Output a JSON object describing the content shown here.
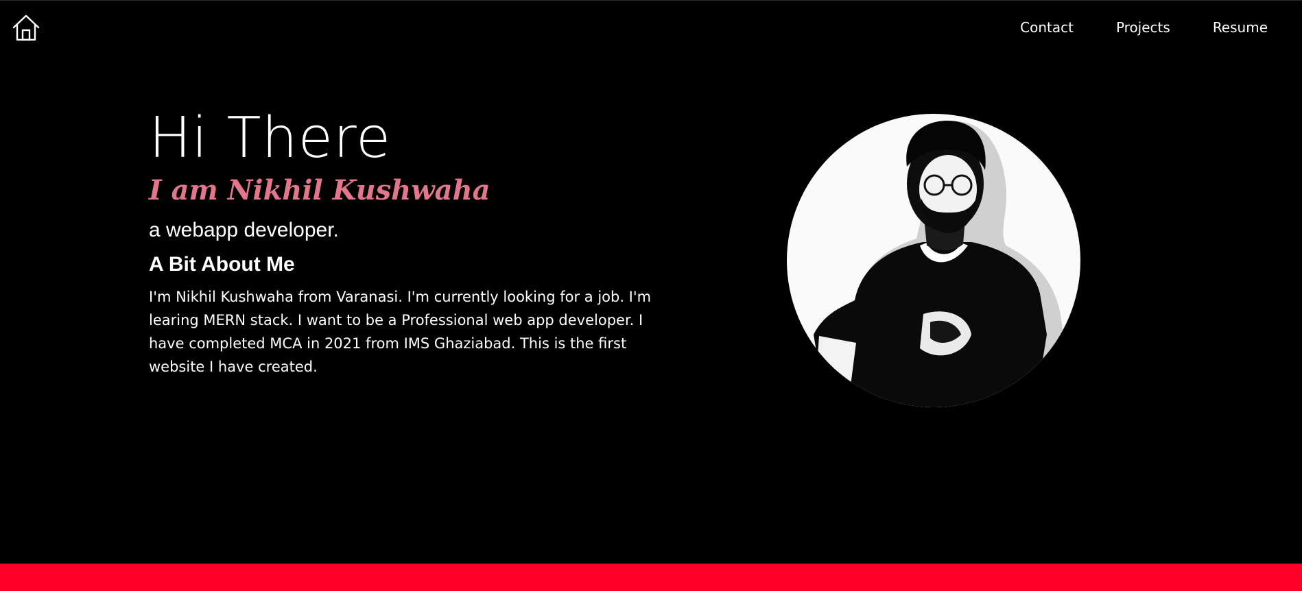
{
  "nav": {
    "home_icon": "home-icon",
    "items": [
      "Contact",
      "Projects",
      "Resume"
    ]
  },
  "hero": {
    "greeting": "Hi There",
    "name_line": "I am Nikhil Kushwaha",
    "role": "a webapp developer.",
    "about_title": "A Bit About Me",
    "about_text": "I'm Nikhil Kushwaha from Varanasi. I'm currently looking for a job. I'm learing MERN stack. I want to be a Professional web app developer. I have completed MCA in 2021 from IMS Ghaziabad. This is the first website I have created."
  },
  "colors": {
    "background": "#000000",
    "accent_name": "#e2768a",
    "footer_bar": "#ff0026"
  }
}
